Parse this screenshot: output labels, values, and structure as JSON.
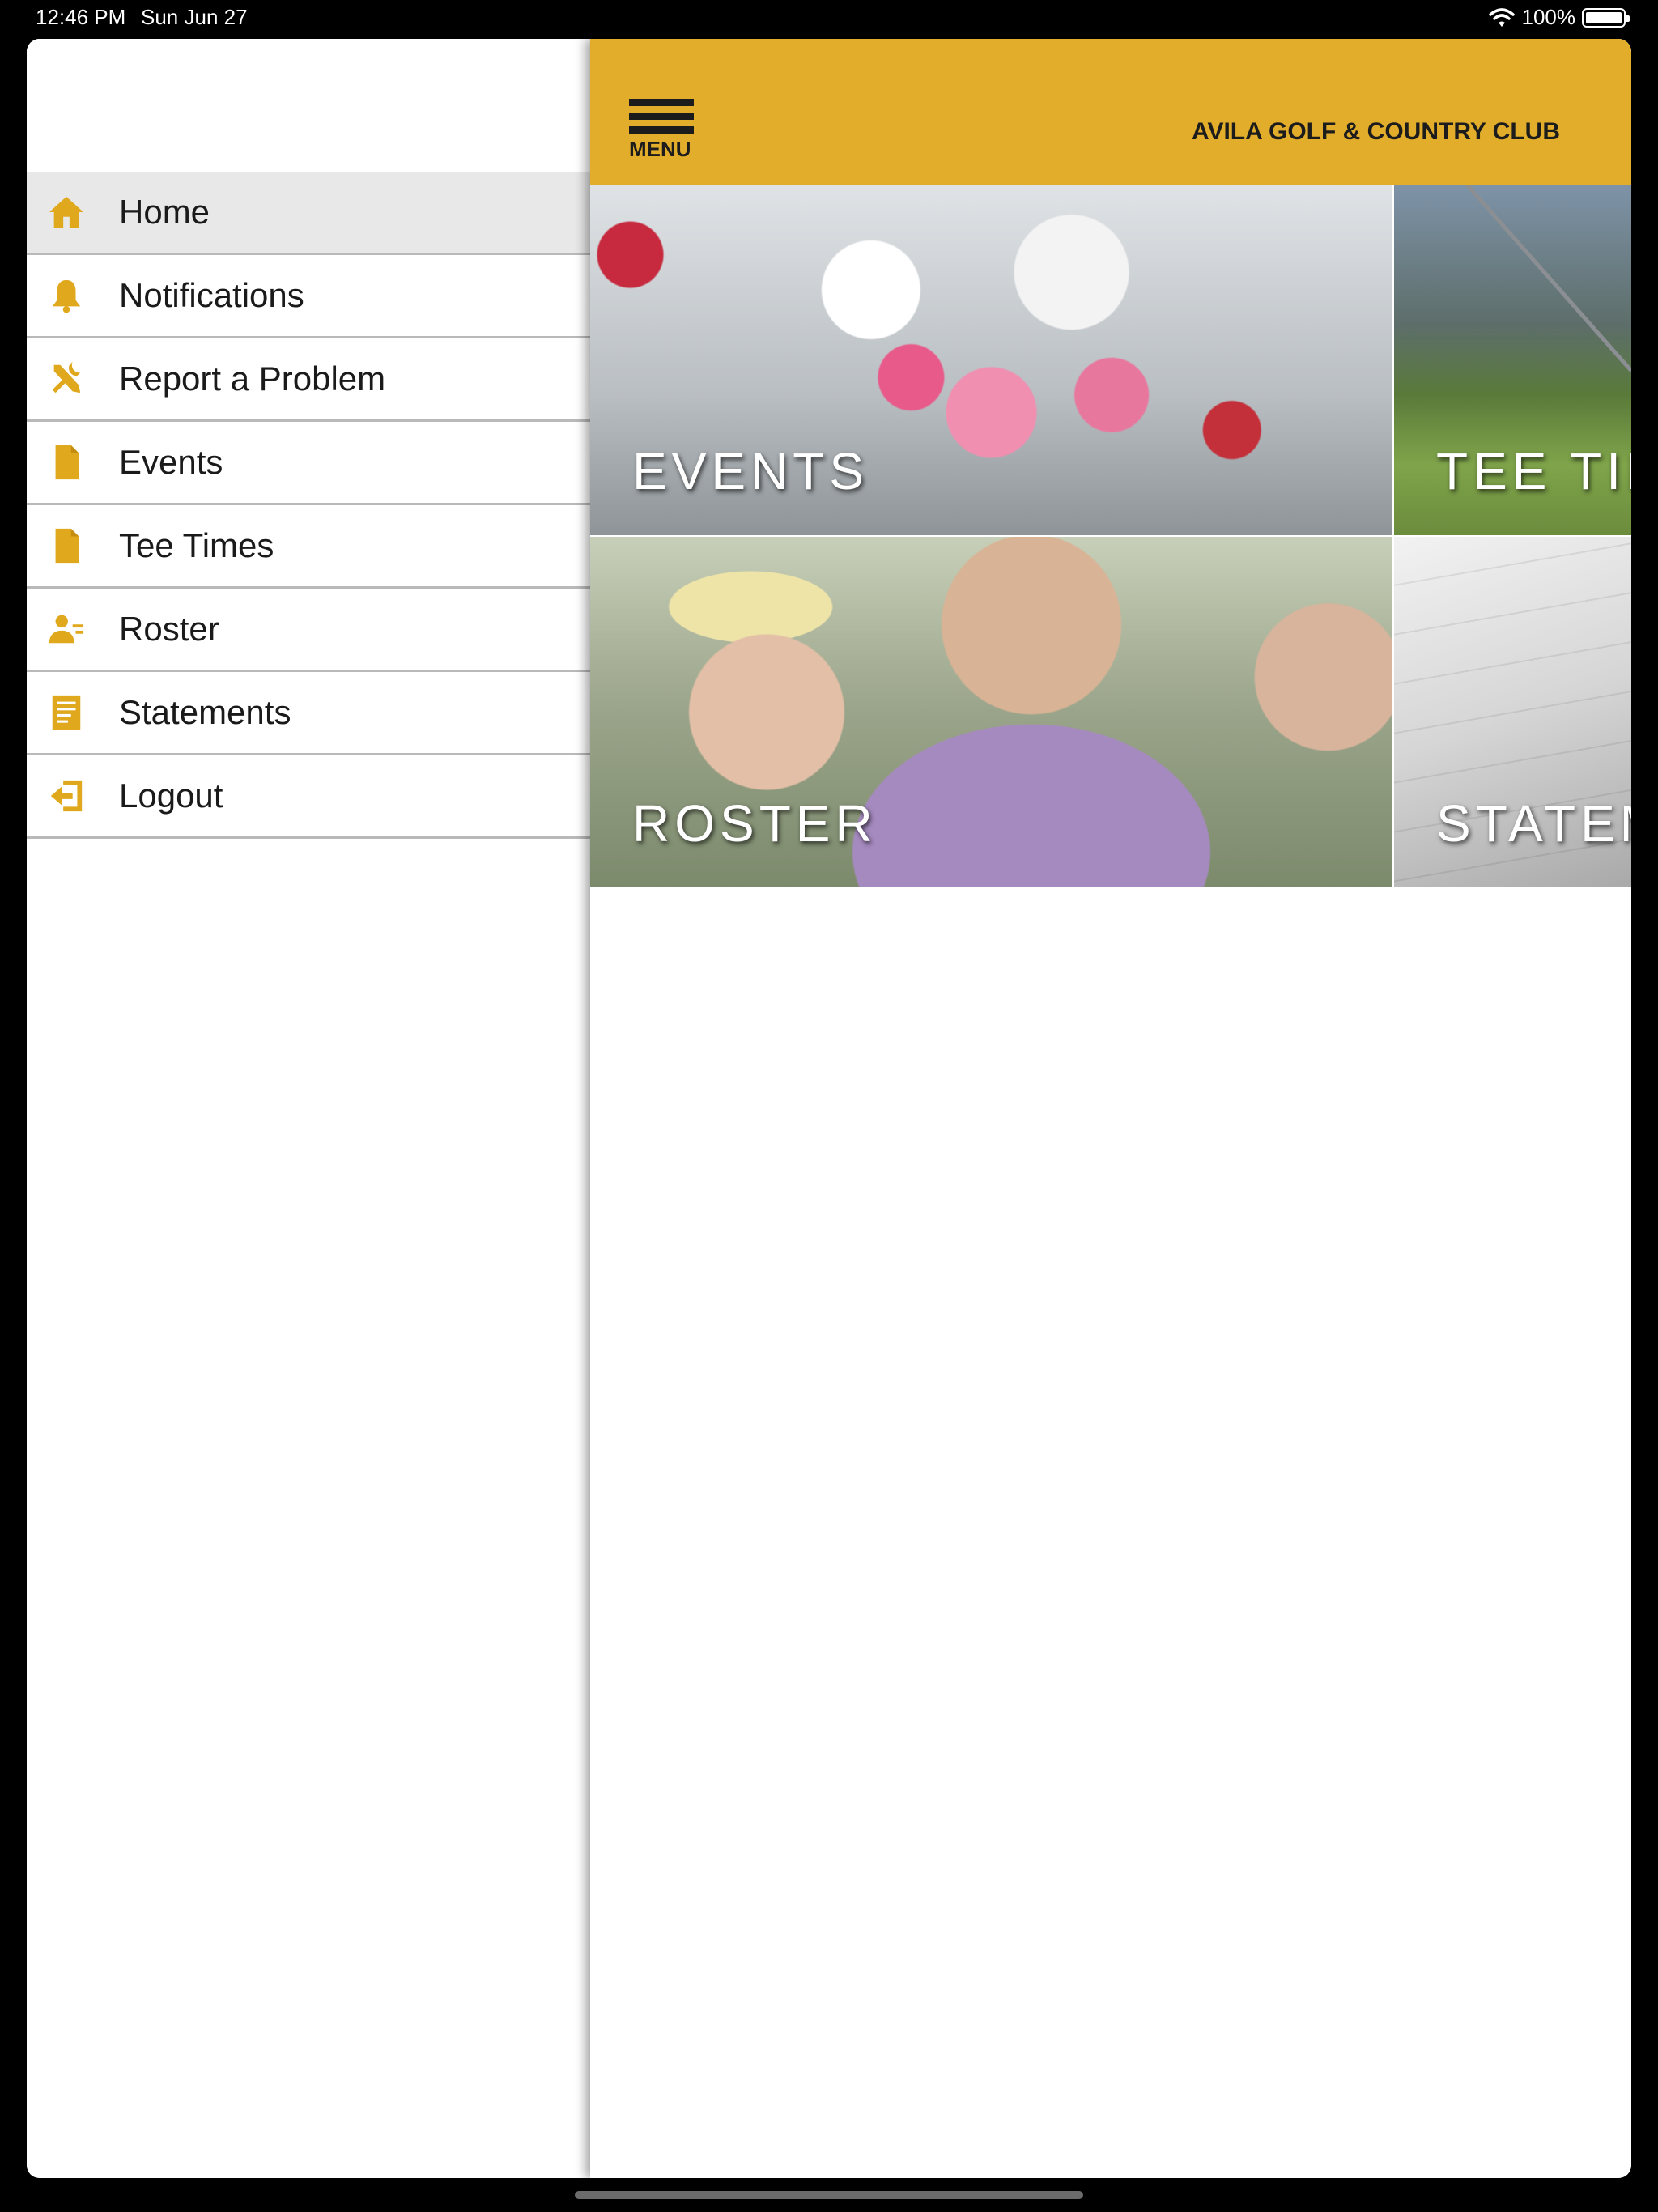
{
  "status_bar": {
    "time": "12:46 PM",
    "date": "Sun Jun 27",
    "battery": "100%"
  },
  "sidebar": {
    "items": [
      {
        "label": "Home",
        "icon": "home-icon",
        "active": true
      },
      {
        "label": "Notifications",
        "icon": "bell-icon",
        "active": false
      },
      {
        "label": "Report a Problem",
        "icon": "tools-icon",
        "active": false
      },
      {
        "label": "Events",
        "icon": "document-icon",
        "active": false
      },
      {
        "label": "Tee Times",
        "icon": "document-icon",
        "active": false
      },
      {
        "label": "Roster",
        "icon": "user-list-icon",
        "active": false
      },
      {
        "label": "Statements",
        "icon": "statement-icon",
        "active": false
      },
      {
        "label": "Logout",
        "icon": "logout-icon",
        "active": false
      }
    ]
  },
  "header": {
    "menu_label": "MENU",
    "club_name": "AVILA GOLF & COUNTRY CLUB"
  },
  "tiles": {
    "events": "EVENTS",
    "tee_times": "TEE TIM",
    "roster": "ROSTER",
    "statements": "STATEM"
  },
  "colors": {
    "accent": "#e2ad2b",
    "icon": "#e0a81c",
    "active_row": "#e8e8e8"
  }
}
